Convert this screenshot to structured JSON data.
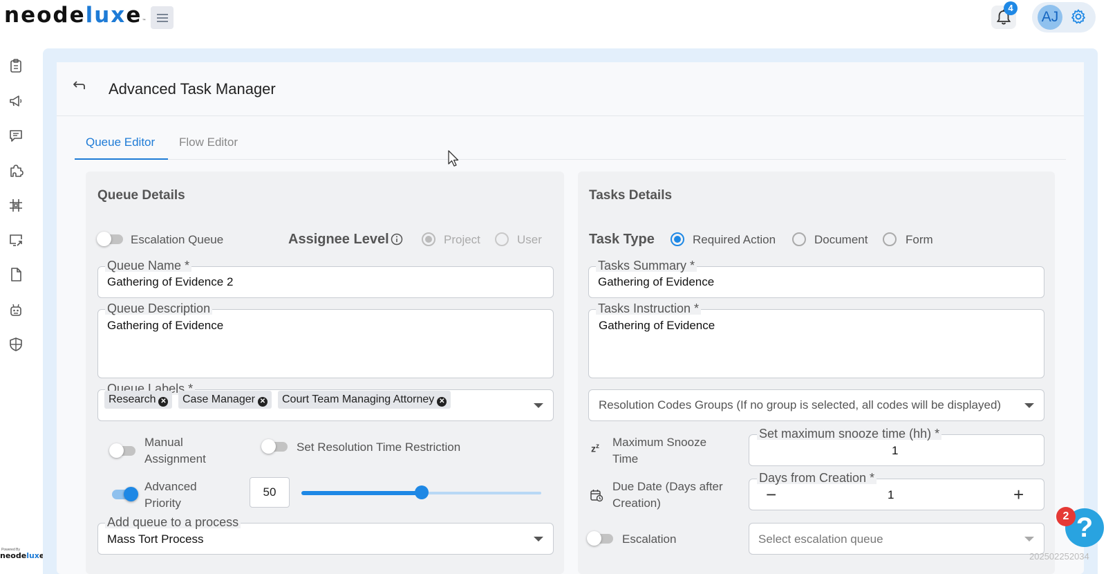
{
  "app": {
    "logo_prefix": "neode",
    "logo_accent": "lux",
    "logo_suffix": "e",
    "logo_tm": "™",
    "notification_count": "4",
    "avatar_initials": "AJ",
    "powered_by": "Powered By",
    "powered_logo_prefix": "neode",
    "powered_logo_accent": "lux",
    "powered_logo_suffix": "e"
  },
  "sidebar": {
    "icons": [
      "clipboard-icon",
      "megaphone-icon",
      "chat-icon",
      "puzzle-icon",
      "grid-icon",
      "screen-share-icon",
      "document-icon",
      "robot-icon",
      "shield-icon"
    ]
  },
  "page": {
    "title": "Advanced Task Manager",
    "tabs": [
      {
        "label": "Queue Editor",
        "active": true
      },
      {
        "label": "Flow Editor",
        "active": false
      }
    ]
  },
  "queue_details": {
    "title": "Queue Details",
    "escalation_queue_label": "Escalation Queue",
    "escalation_queue_on": false,
    "assignee_level_label": "Assignee Level",
    "assignee_options": [
      "Project",
      "User"
    ],
    "assignee_selected": "Project",
    "queue_name_label": "Queue Name *",
    "queue_name_value": "Gathering of Evidence 2",
    "queue_description_label": "Queue Description",
    "queue_description_value": "Gathering of Evidence",
    "queue_labels_label": "Queue Labels *",
    "queue_labels": [
      "Research",
      "Case Manager",
      "Court Team Managing Attorney"
    ],
    "manual_assignment_line1": "Manual",
    "manual_assignment_line2": "Assignment",
    "manual_assignment_on": false,
    "resolution_time_label": "Set Resolution Time Restriction",
    "resolution_time_on": false,
    "advanced_priority_line1": "Advanced",
    "advanced_priority_line2": "Priority",
    "advanced_priority_on": true,
    "priority_value": "50",
    "priority_fraction": 0.5,
    "add_to_process_label": "Add queue to a process",
    "add_to_process_value": "Mass Tort Process"
  },
  "tasks_details": {
    "title": "Tasks Details",
    "task_type_label": "Task Type",
    "task_type_options": [
      "Required Action",
      "Document",
      "Form"
    ],
    "task_type_selected": "Required Action",
    "tasks_summary_label": "Tasks Summary *",
    "tasks_summary_value": "Gathering of Evidence",
    "tasks_instruction_label": "Tasks Instruction *",
    "tasks_instruction_value": "Gathering of Evidence",
    "resolution_codes_placeholder": "Resolution Codes Groups (If no group is selected, all codes will be displayed)",
    "max_snooze_line1": "Maximum Snooze",
    "max_snooze_line2": "Time",
    "snooze_field_label": "Set maximum snooze time (hh) *",
    "snooze_value": "1",
    "due_date_line1": "Due Date (Days after",
    "due_date_line2": "Creation)",
    "days_field_label": "Days from Creation *",
    "days_value": "1",
    "escalation_label": "Escalation",
    "escalation_on": false,
    "escalation_queue_placeholder": "Select escalation queue"
  },
  "help": {
    "badge_count": "2",
    "glyph": "?"
  },
  "build_id": "202502252034",
  "colors": {
    "accent": "#1e88e5",
    "brand": "#1e7bd6",
    "badge_red": "#e53935",
    "panel_bg": "#f0f1f3",
    "main_bg": "#e3effb"
  }
}
